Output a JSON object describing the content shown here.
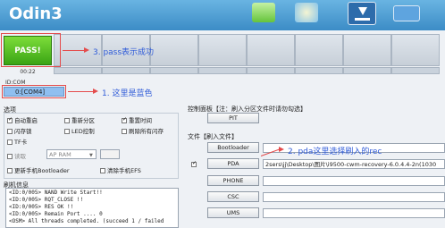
{
  "app": {
    "title": "Odin3"
  },
  "status": {
    "pass_label": "PASS!",
    "elapsed": "00:22"
  },
  "annotations": {
    "a1": "3. pass表示成功",
    "a2": "1. 这里是蓝色",
    "a3": "2. pda这里选择刷入的rec"
  },
  "connection": {
    "id_com_label": "ID:COM",
    "port_value": "0:[COM4]"
  },
  "options": {
    "section_label": "选项",
    "items": [
      {
        "label": "自动重启",
        "checked": true
      },
      {
        "label": "重新分区",
        "checked": false
      },
      {
        "label": "重置时间",
        "checked": true
      },
      {
        "label": "闪存锁",
        "checked": false
      },
      {
        "label": "LED控制",
        "checked": false
      },
      {
        "label": "刷除所有闪存",
        "checked": false
      },
      {
        "label": "TF卡",
        "checked": false
      }
    ],
    "read_label": "读取",
    "ap_ram_value": "AP RAM",
    "bootloader_label": "更新手机Bootloader",
    "efs_label": "清除手机EFS"
  },
  "log": {
    "section_label": "刷机信息",
    "lines": [
      "<ID:0/005> NAND Write Start!!",
      "<ID:0/005> RQT_CLOSE !!",
      "<ID:0/005> RES OK !!",
      "<ID:0/005> Remain Port .... 0",
      "<OSM> All threads completed. (succeed 1 / failed"
    ]
  },
  "control": {
    "section_label": "控制面板【注：刷入分区文件时请勿勾选】",
    "pit_label": "PIT"
  },
  "files": {
    "section_label": "文件【刷入文件】",
    "rows": [
      {
        "button": "Bootloader",
        "checked": false,
        "path": ""
      },
      {
        "button": "PDA",
        "checked": true,
        "path": "2sers\\jj\\Desktop\\图片\\i9500-cwm-recovery-6.0.4.4-2n(1030"
      },
      {
        "button": "PHONE",
        "checked": false,
        "path": ""
      },
      {
        "button": "CSC",
        "checked": false,
        "path": ""
      },
      {
        "button": "UMS",
        "checked": false,
        "path": ""
      }
    ]
  }
}
